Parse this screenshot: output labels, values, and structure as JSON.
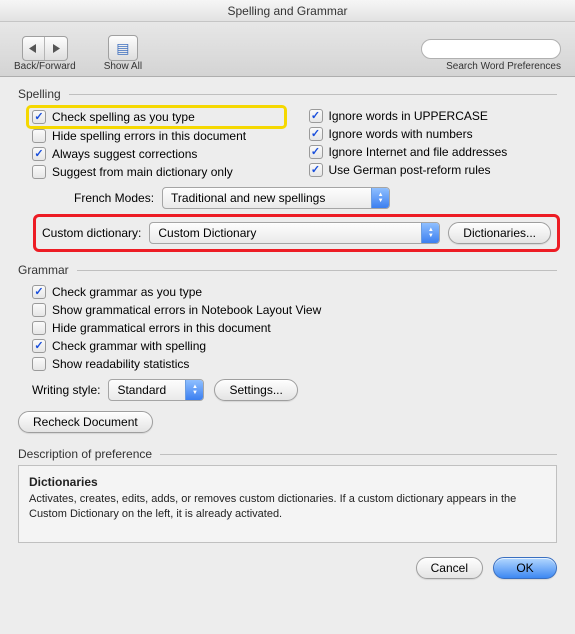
{
  "title": "Spelling and Grammar",
  "toolbar": {
    "back_forward_label": "Back/Forward",
    "show_all_label": "Show All",
    "search_placeholder": "",
    "search_label": "Search Word Preferences"
  },
  "spelling": {
    "section_label": "Spelling",
    "left": [
      {
        "label": "Check spelling as you type",
        "checked": true,
        "highlight": true,
        "name": "check-spelling-as-you-type"
      },
      {
        "label": "Hide spelling errors in this document",
        "checked": false,
        "name": "hide-spelling-errors"
      },
      {
        "label": "Always suggest corrections",
        "checked": true,
        "name": "always-suggest-corrections"
      },
      {
        "label": "Suggest from main dictionary only",
        "checked": false,
        "name": "suggest-main-dict-only"
      }
    ],
    "right": [
      {
        "label": "Ignore words in UPPERCASE",
        "checked": true,
        "name": "ignore-uppercase"
      },
      {
        "label": "Ignore words with numbers",
        "checked": true,
        "name": "ignore-numbers"
      },
      {
        "label": "Ignore Internet and file addresses",
        "checked": true,
        "name": "ignore-internet"
      },
      {
        "label": "Use German post-reform rules",
        "checked": true,
        "name": "german-post-reform"
      }
    ],
    "french_label": "French Modes:",
    "french_value": "Traditional and new spellings",
    "custom_label": "Custom dictionary:",
    "custom_value": "Custom Dictionary",
    "dictionaries_btn": "Dictionaries..."
  },
  "grammar": {
    "section_label": "Grammar",
    "items": [
      {
        "label": "Check grammar as you type",
        "checked": true,
        "name": "check-grammar-as-you-type"
      },
      {
        "label": "Show grammatical errors in Notebook Layout View",
        "checked": false,
        "name": "show-errors-notebook"
      },
      {
        "label": "Hide grammatical errors in this document",
        "checked": false,
        "name": "hide-grammar-errors"
      },
      {
        "label": "Check grammar with spelling",
        "checked": true,
        "name": "check-grammar-with-spelling"
      },
      {
        "label": "Show readability statistics",
        "checked": false,
        "name": "show-readability"
      }
    ],
    "writing_style_label": "Writing style:",
    "writing_style_value": "Standard",
    "settings_btn": "Settings...",
    "recheck_btn": "Recheck Document"
  },
  "description": {
    "section_label": "Description of preference",
    "title": "Dictionaries",
    "body": "Activates, creates, edits, adds, or removes custom dictionaries. If a custom dictionary appears in the Custom Dictionary on the left, it is already activated."
  },
  "footer": {
    "cancel": "Cancel",
    "ok": "OK"
  }
}
